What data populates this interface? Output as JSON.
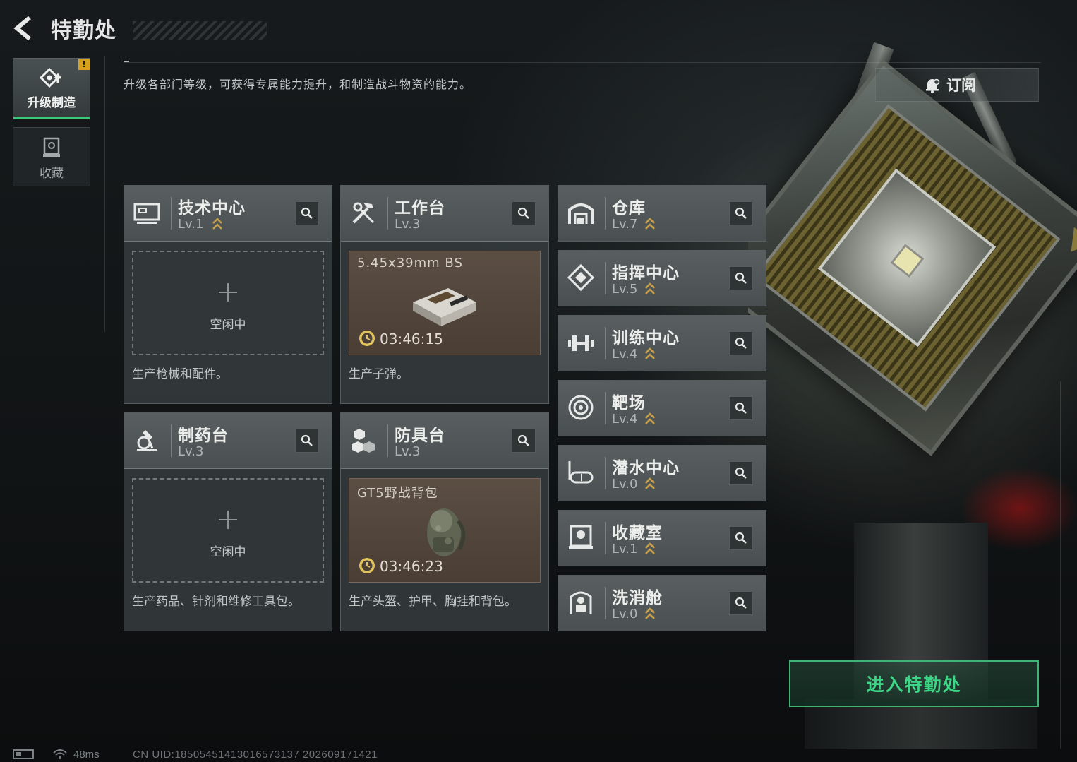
{
  "header": {
    "title": "特勤处"
  },
  "sidebar": {
    "tabs": [
      {
        "label": "升级制造",
        "icon": "upgrade-icon",
        "active": true,
        "badge": "!"
      },
      {
        "label": "收藏",
        "icon": "collection-icon",
        "active": false
      }
    ]
  },
  "main": {
    "description": "升级各部门等级，可获得专属能力提升，和制造战斗物资的能力。",
    "subscribe_label": "订阅",
    "enter_label": "进入特勤处"
  },
  "workshops": [
    {
      "name": "技术中心",
      "level": "Lv.1",
      "upgradable": true,
      "icon": "monitor-icon",
      "slot": {
        "state": "idle",
        "label": "空闲中"
      },
      "desc": "生产枪械和配件。"
    },
    {
      "name": "工作台",
      "level": "Lv.3",
      "upgradable": false,
      "icon": "tools-icon",
      "slot": {
        "state": "busy",
        "item": "5.45x39mm BS",
        "item_icon": "ammo-box-icon",
        "timer": "03:46:15"
      },
      "desc": "生产子弹。"
    },
    {
      "name": "制药台",
      "level": "Lv.3",
      "upgradable": false,
      "icon": "microscope-icon",
      "slot": {
        "state": "idle",
        "label": "空闲中"
      },
      "desc": "生产药品、针剂和维修工具包。"
    },
    {
      "name": "防具台",
      "level": "Lv.3",
      "upgradable": false,
      "icon": "armor-parts-icon",
      "slot": {
        "state": "busy",
        "item": "GT5野战背包",
        "item_icon": "backpack-icon",
        "timer": "03:46:23"
      },
      "desc": "生产头盔、护甲、胸挂和背包。"
    }
  ],
  "facilities": [
    {
      "name": "仓库",
      "level": "Lv.7",
      "upgradable": true,
      "icon": "warehouse-icon"
    },
    {
      "name": "指挥中心",
      "level": "Lv.5",
      "upgradable": true,
      "icon": "command-icon"
    },
    {
      "name": "训练中心",
      "level": "Lv.4",
      "upgradable": true,
      "icon": "dumbbell-icon"
    },
    {
      "name": "靶场",
      "level": "Lv.4",
      "upgradable": true,
      "icon": "target-icon"
    },
    {
      "name": "潜水中心",
      "level": "Lv.0",
      "upgradable": true,
      "icon": "diving-mask-icon"
    },
    {
      "name": "收藏室",
      "level": "Lv.1",
      "upgradable": true,
      "icon": "display-case-icon"
    },
    {
      "name": "洗消舱",
      "level": "Lv.0",
      "upgradable": true,
      "icon": "decon-chamber-icon"
    }
  ],
  "status": {
    "ping": "48ms",
    "uid": "CN UID:18505451413016573137 202609171421"
  },
  "colors": {
    "accent_green": "#3cd786",
    "badge_yellow": "#d6a11c",
    "upgrade_gold": "#c8a04a"
  }
}
